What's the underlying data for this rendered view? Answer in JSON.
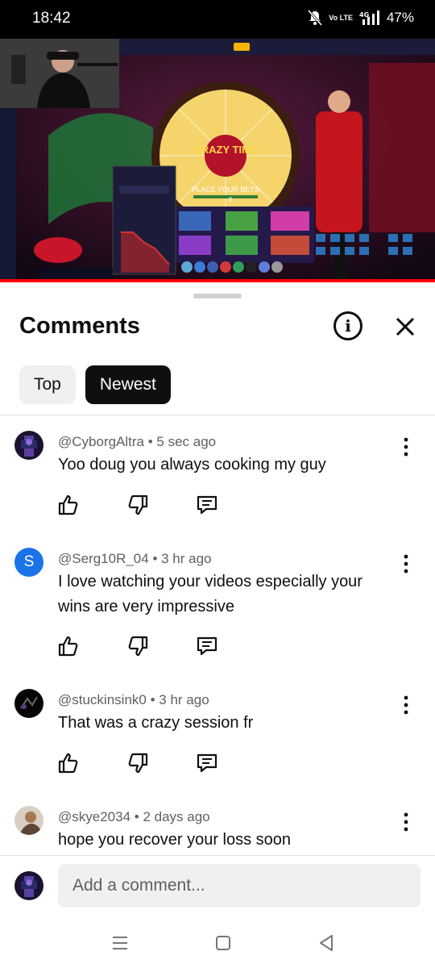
{
  "status_bar": {
    "time": "18:42",
    "network": "4G",
    "lte": "Vo LTE",
    "battery": "47%"
  },
  "video": {
    "wheel_title": "CRAZY TIME",
    "place_bets": "PLACE YOUR BETS",
    "countdown": "8",
    "progress_fraction": 1.0
  },
  "sheet": {
    "title": "Comments",
    "info_icon": "info-icon",
    "close_icon": "close-icon",
    "chips": [
      {
        "label": "Top",
        "active": false
      },
      {
        "label": "Newest",
        "active": true
      }
    ]
  },
  "comments": [
    {
      "author": "@CyborgAltra",
      "time": "5 sec ago",
      "text": "Yoo doug you always cooking my guy",
      "avatar": "avatar-dark"
    },
    {
      "author": "@Serg10R_04",
      "time": "3 hr ago",
      "text": "I love watching your videos especially your wins are very impressive",
      "avatar": "S"
    },
    {
      "author": "@stuckinsink0",
      "time": "3 hr ago",
      "text": "That was a crazy session fr",
      "avatar": "avatar-black"
    },
    {
      "author": "@skye2034",
      "time": "2 days ago",
      "text": "hope you recover your loss soon",
      "avatar": "avatar-photo"
    }
  ],
  "composer": {
    "placeholder": "Add a comment..."
  },
  "colors": {
    "accent_red": "#ff0000",
    "avatar_blue": "#1a73e8",
    "text_primary": "#0f0f0f",
    "text_secondary": "#606060"
  }
}
